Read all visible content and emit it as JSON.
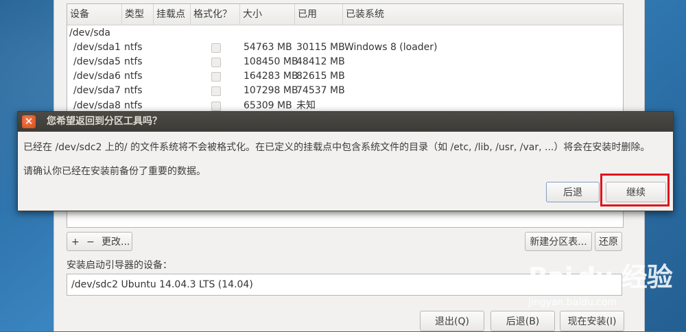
{
  "table": {
    "columns": [
      "设备",
      "类型",
      "挂载点",
      "格式化？",
      "大小",
      "已用",
      "已装系统"
    ],
    "disk": "/dev/sda",
    "rows": [
      {
        "device": "/dev/sda1",
        "type": "ntfs",
        "mount": "",
        "format": false,
        "size": "54763 MB",
        "used": "30115 MB",
        "system": "Windows 8 (loader)"
      },
      {
        "device": "/dev/sda5",
        "type": "ntfs",
        "mount": "",
        "format": false,
        "size": "108450 MB",
        "used": "48412 MB",
        "system": ""
      },
      {
        "device": "/dev/sda6",
        "type": "ntfs",
        "mount": "",
        "format": false,
        "size": "164283 MB",
        "used": "82615 MB",
        "system": ""
      },
      {
        "device": "/dev/sda7",
        "type": "ntfs",
        "mount": "",
        "format": false,
        "size": "107298 MB",
        "used": "74537 MB",
        "system": ""
      },
      {
        "device": "/dev/sda8",
        "type": "ntfs",
        "mount": "",
        "format": false,
        "size": "65309 MB",
        "used": "未知",
        "system": ""
      }
    ]
  },
  "toolbar": {
    "add_label": "+",
    "remove_label": "−",
    "change_label": "更改...",
    "new_table_label": "新建分区表...",
    "revert_label": "还原"
  },
  "bootloader": {
    "label": "安装启动引导器的设备：",
    "value": "/dev/sdc2   Ubuntu 14.04.3 LTS (14.04)"
  },
  "footer": {
    "quit_label": "退出(Q)",
    "back_label": "后退(B)",
    "install_label": "现在安装(I)"
  },
  "dialog": {
    "title": "您希望返回到分区工具吗？",
    "close_glyph": "✕",
    "message1": "已经在 /dev/sdc2 上的/ 的文件系统将不会被格式化。在已定义的挂载点中包含系统文件的目录（如 /etc, /lib, /usr, /var, ...）将会在安装时删除。",
    "message2": "请确认你已经在安装前备份了重要的数据。",
    "back_label": "后退",
    "continue_label": "继续",
    "highlight_color": "#e0141a"
  },
  "watermark": {
    "brand": "Bai du 经验",
    "url": "jingyan.baidu.com"
  }
}
